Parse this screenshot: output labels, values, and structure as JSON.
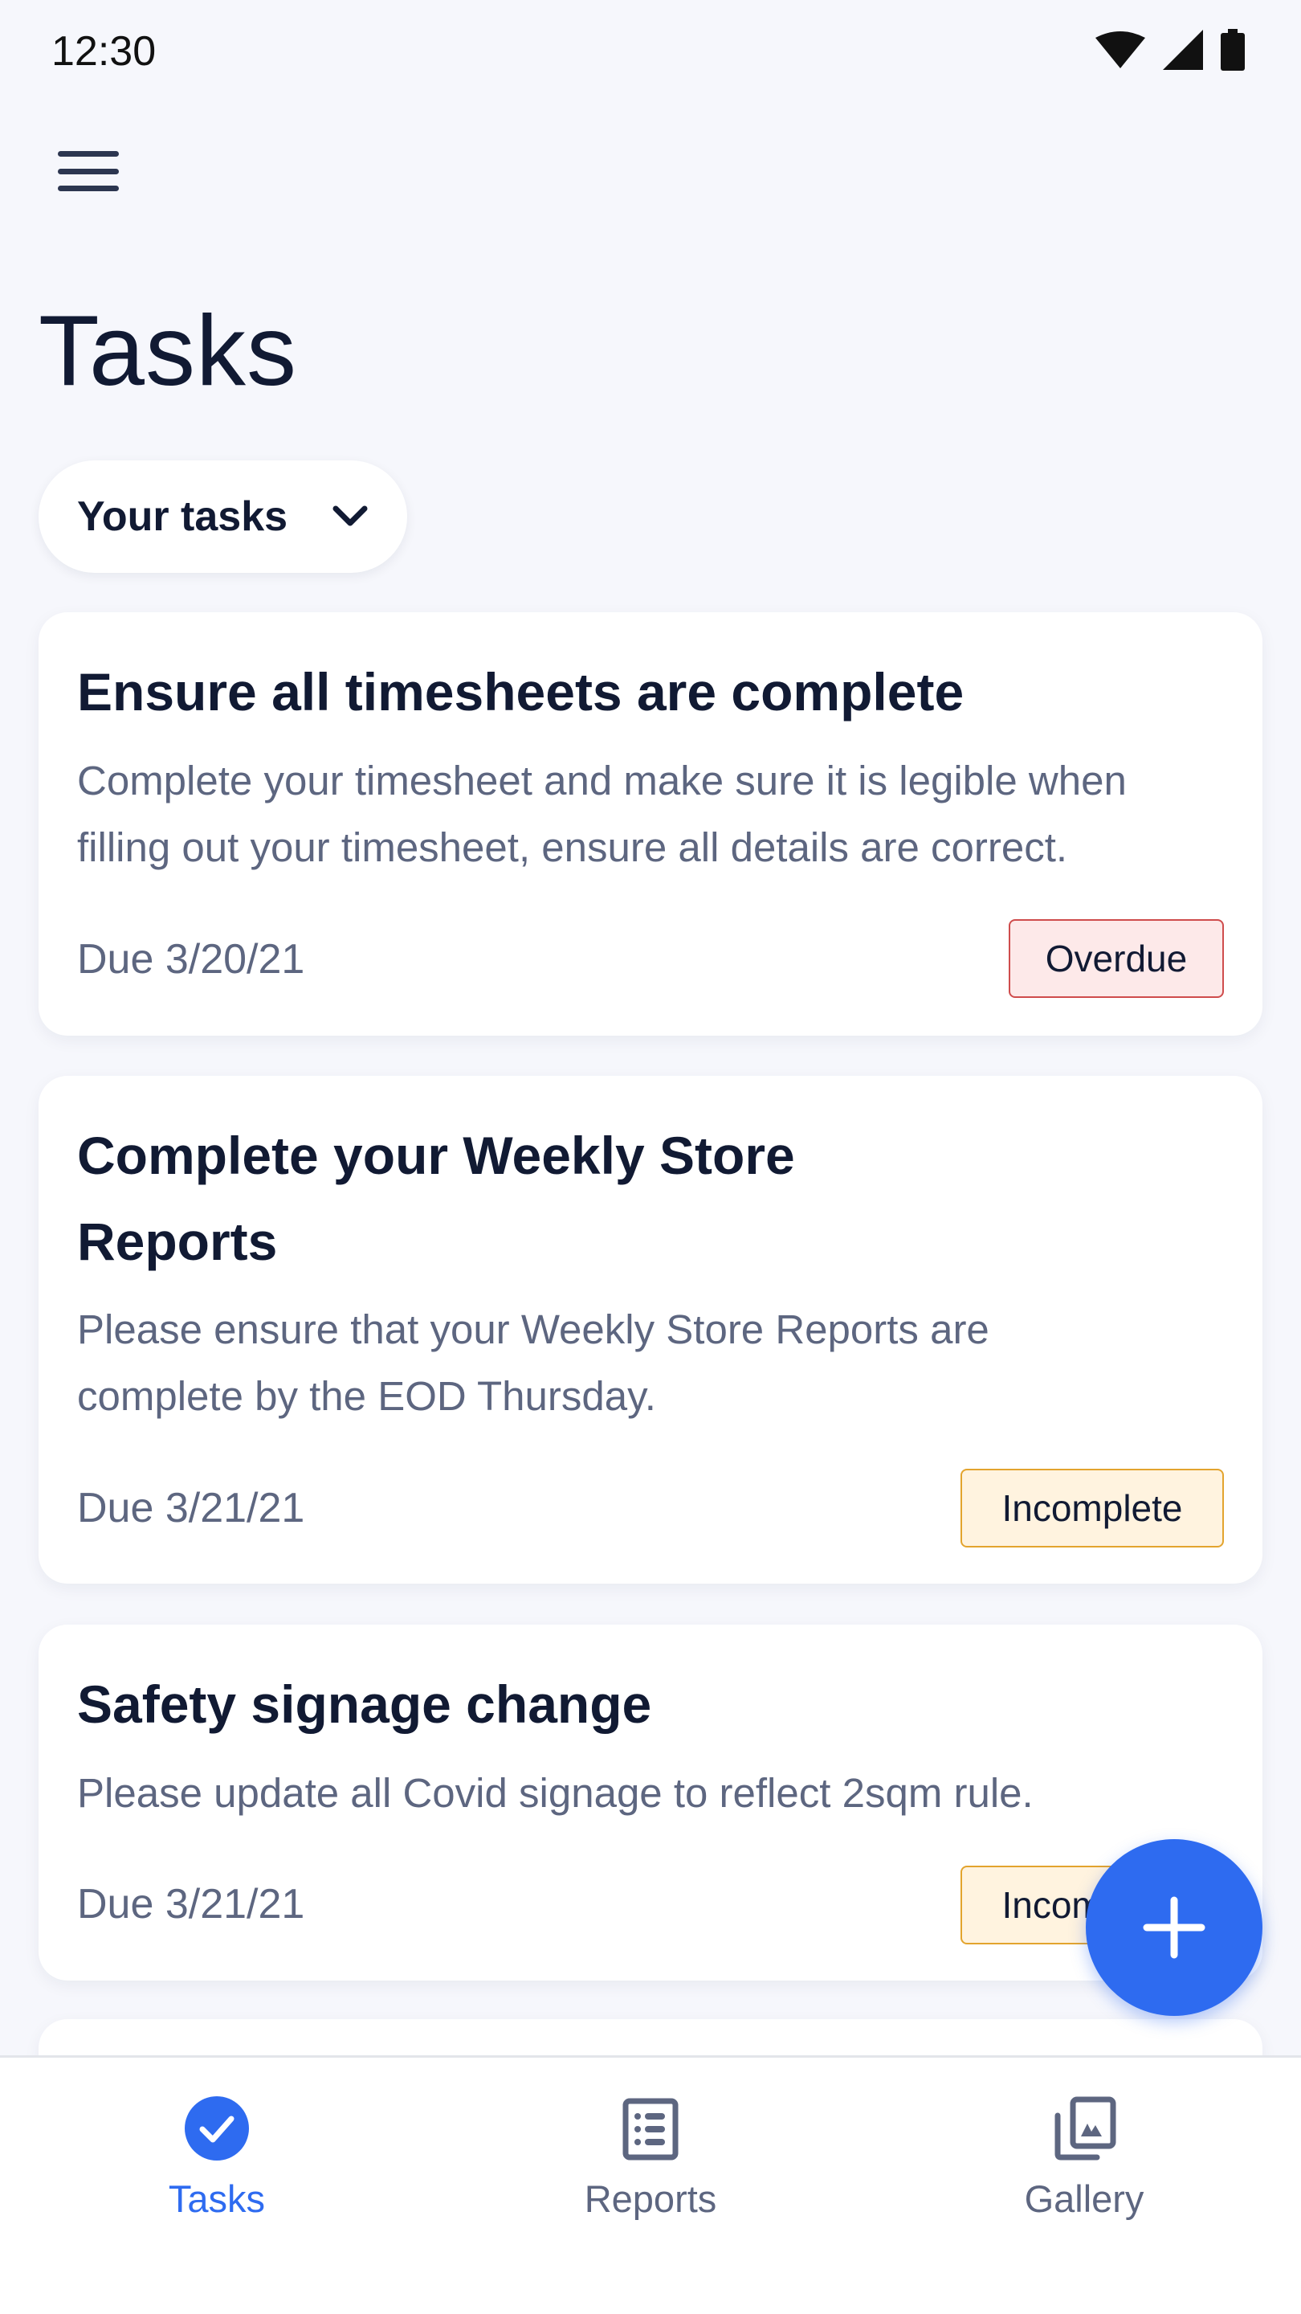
{
  "status_bar": {
    "time": "12:30",
    "icons": [
      "wifi-icon",
      "signal-icon",
      "battery-icon"
    ]
  },
  "header": {
    "menu_icon": "hamburger-menu-icon",
    "title": "Tasks"
  },
  "filter": {
    "selected": "Your tasks",
    "icon": "chevron-down-icon"
  },
  "tasks": [
    {
      "title": "Ensure all timesheets are complete",
      "description": "Complete your timesheet and make sure it is legible when filling out your timesheet, ensure all details are correct.",
      "due": "Due 3/20/21",
      "status": "Overdue"
    },
    {
      "title": "Complete your Weekly Store Reports",
      "description": "Please ensure that your Weekly Store Reports are complete by the EOD Thursday.",
      "due": "Due 3/21/21",
      "status": "Incomplete"
    },
    {
      "title": "Safety signage change",
      "description": "Please update all Covid signage to reflect 2sqm rule.",
      "due": "Due 3/21/21",
      "status": "Incomplete"
    }
  ],
  "fab": {
    "icon": "plus-icon"
  },
  "bottom_nav": {
    "items": [
      {
        "label": "Tasks",
        "icon": "check-circle-icon",
        "active": true
      },
      {
        "label": "Reports",
        "icon": "list-icon"
      },
      {
        "label": "Gallery",
        "icon": "gallery-icon"
      }
    ]
  },
  "colors": {
    "accent": "#2e6bf0",
    "overdue_bg": "#fde9e9",
    "overdue_border": "#cf4c4c",
    "incomplete_bg": "#fff3df",
    "incomplete_border": "#e3a42e",
    "background": "#f6f7fc"
  }
}
